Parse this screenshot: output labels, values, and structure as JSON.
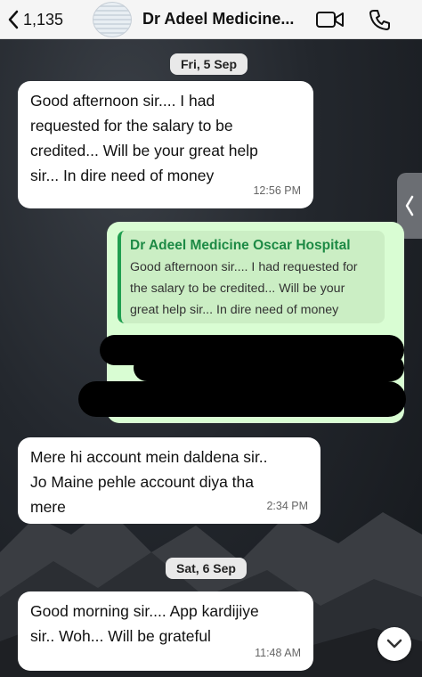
{
  "header": {
    "back_count": "1,135",
    "contact_name": "Dr Adeel Medicine...",
    "icons": [
      "chevron-left-icon",
      "avatar",
      "video-call-icon",
      "phone-icon"
    ]
  },
  "messages": {
    "date1": "Fri, 5 Sep",
    "msg1": {
      "line1": "Good afternoon sir.... I had",
      "line2": "requested for the salary to be",
      "line3": "credited... Will be your great help",
      "line4": "sir... In dire need of money",
      "time": "12:56 PM"
    },
    "reply": {
      "quote_name": "Dr Adeel Medicine Oscar Hospital",
      "quote_line1": "Good afternoon sir.... I had requested for",
      "quote_line2": "the salary to be credited... Will be your",
      "quote_line3": "great help sir... In dire need of money"
    },
    "msg2": {
      "line1": "Mere hi account mein daldena sir..",
      "line2": "Jo Maine pehle account diya tha",
      "line3": "mere",
      "time": "2:34 PM"
    },
    "date2": "Sat, 6 Sep",
    "msg3": {
      "line1": "Good morning sir.... App kardijiye",
      "line2": "sir.. Woh... Will be grateful",
      "time": "11:48 AM"
    }
  },
  "colors": {
    "incoming_bubble": "#ffffff",
    "outgoing_bubble": "#d9fdd3",
    "quote_accent": "#1f9e4f"
  }
}
